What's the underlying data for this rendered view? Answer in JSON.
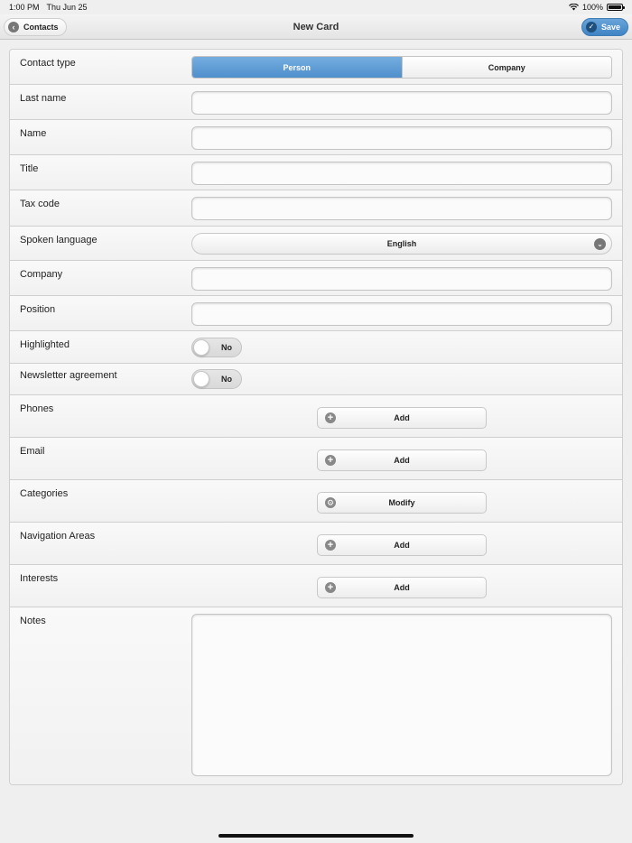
{
  "status_bar": {
    "time": "1:00 PM",
    "date": "Thu Jun 25",
    "battery": "100%"
  },
  "nav": {
    "title": "New Card",
    "back_label": "Contacts",
    "save_label": "Save"
  },
  "form": {
    "contact_type": {
      "label": "Contact type",
      "options": [
        "Person",
        "Company"
      ],
      "selected": "Person"
    },
    "last_name": {
      "label": "Last name",
      "value": ""
    },
    "name": {
      "label": "Name",
      "value": ""
    },
    "title": {
      "label": "Title",
      "value": ""
    },
    "tax_code": {
      "label": "Tax code",
      "value": ""
    },
    "spoken_language": {
      "label": "Spoken language",
      "value": "English"
    },
    "company": {
      "label": "Company",
      "value": ""
    },
    "position": {
      "label": "Position",
      "value": ""
    },
    "highlighted": {
      "label": "Highlighted",
      "value": "No"
    },
    "newsletter": {
      "label": "Newsletter agreement",
      "value": "No"
    },
    "phones": {
      "label": "Phones",
      "action": "Add"
    },
    "email": {
      "label": "Email",
      "action": "Add"
    },
    "categories": {
      "label": "Categories",
      "action": "Modify"
    },
    "navigation_areas": {
      "label": "Navigation Areas",
      "action": "Add"
    },
    "interests": {
      "label": "Interests",
      "action": "Add"
    },
    "notes": {
      "label": "Notes",
      "value": ""
    }
  },
  "icons": {
    "back": "chevron-left-icon",
    "save": "checkmark-icon",
    "add": "plus-circle-icon",
    "modify": "gear-icon",
    "select": "chevron-down-icon"
  },
  "colors": {
    "accent": "#4f8fcc",
    "save_button": "#3f84c4"
  }
}
